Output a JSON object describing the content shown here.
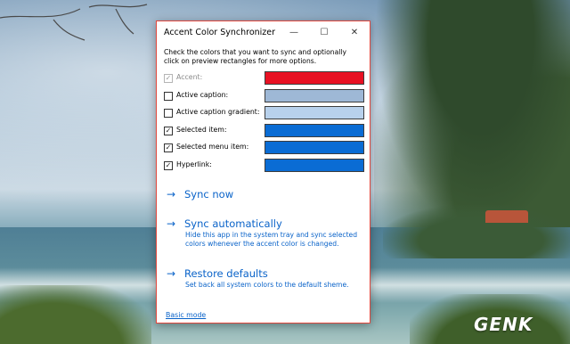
{
  "window": {
    "title": "Accent Color Synchronizer",
    "controls": {
      "minimize": "—",
      "maximize": "☐",
      "close": "✕"
    },
    "instruction": "Check the colors that you want to sync and optionally click on preview rectangles for more options."
  },
  "colors": [
    {
      "label": "Accent:",
      "checked": true,
      "disabled": true,
      "color": "#e81123"
    },
    {
      "label": "Active caption:",
      "checked": false,
      "disabled": false,
      "color": "#9eb8d6"
    },
    {
      "label": "Active caption gradient:",
      "checked": false,
      "disabled": false,
      "color": "#b8d1ec"
    },
    {
      "label": "Selected item:",
      "checked": true,
      "disabled": false,
      "color": "#0a6cd4"
    },
    {
      "label": "Selected menu item:",
      "checked": true,
      "disabled": false,
      "color": "#0a6cd4"
    },
    {
      "label": "Hyperlink:",
      "checked": true,
      "disabled": false,
      "color": "#0a6cd4"
    }
  ],
  "actions": {
    "sync_now": {
      "label": "Sync now"
    },
    "sync_auto": {
      "label": "Sync automatically",
      "desc": "Hide this app in the system tray and sync selected colors whenever the accent color is changed."
    },
    "restore": {
      "label": "Restore defaults",
      "desc": "Set back all system colors to the default sheme."
    }
  },
  "footer": {
    "basic_mode": "Basic mode"
  },
  "icons": {
    "arrow": "→",
    "check": "✓"
  },
  "desktop": {
    "watermark": "GENK"
  }
}
